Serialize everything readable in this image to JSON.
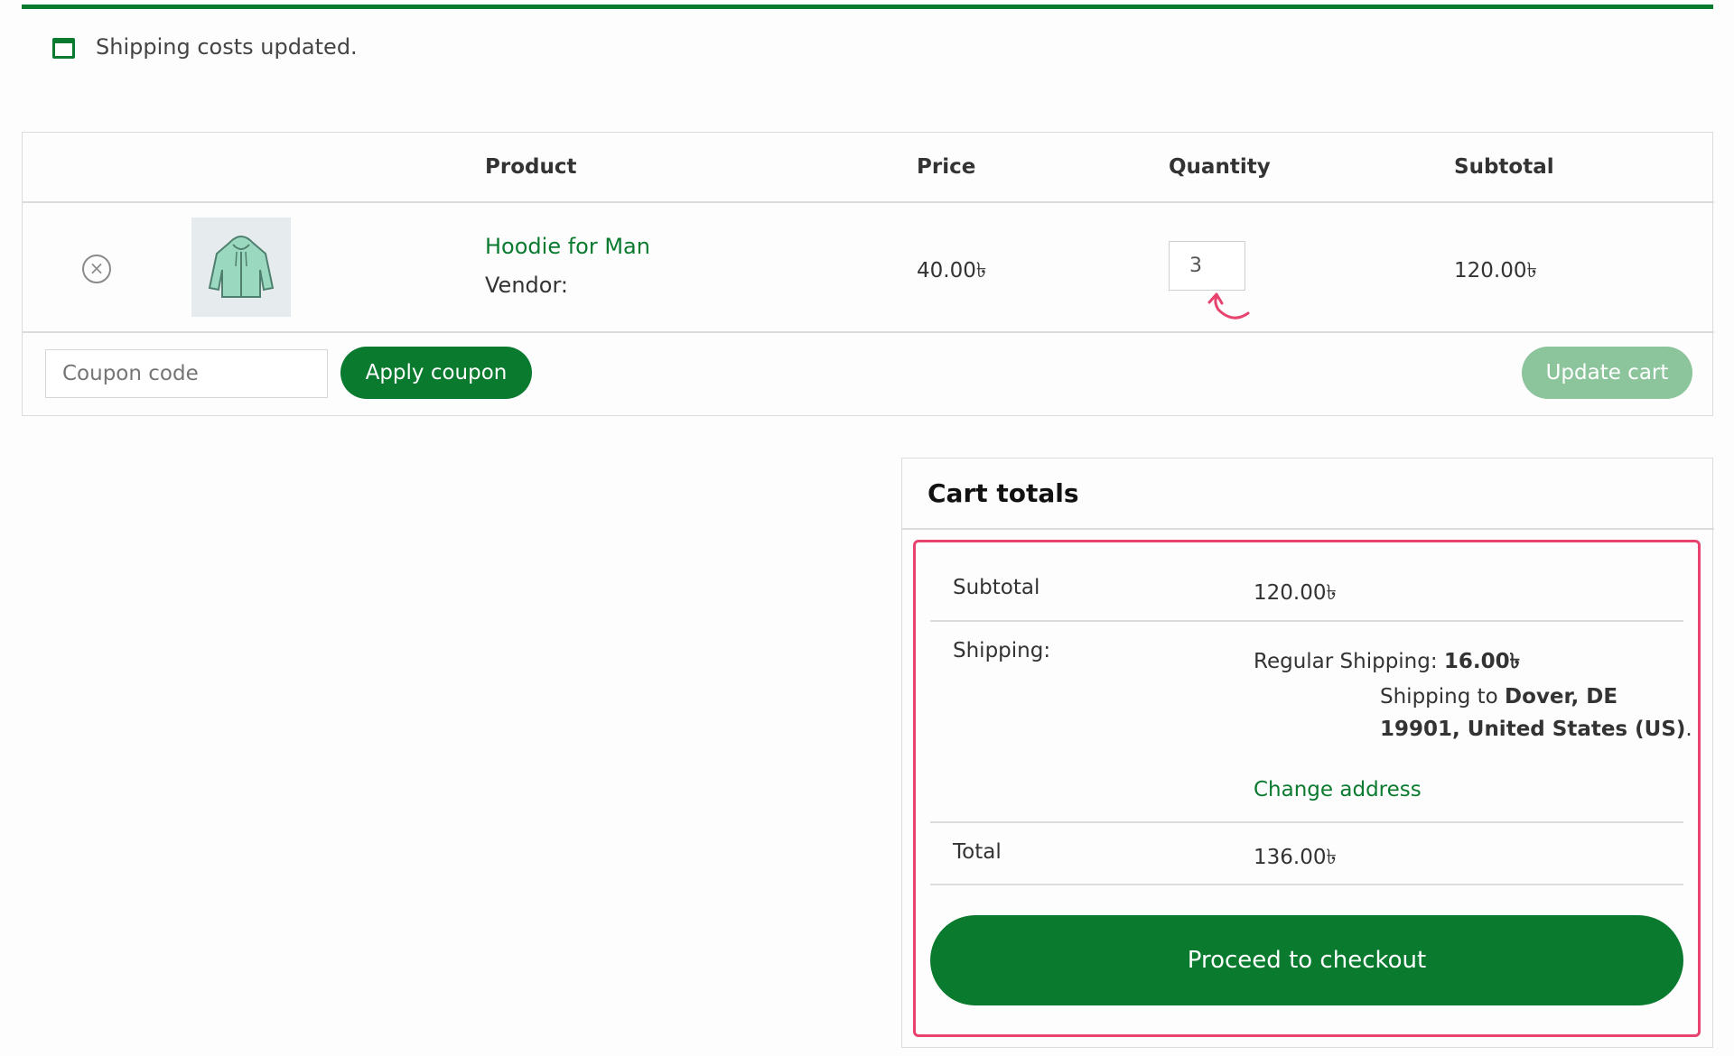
{
  "notice": {
    "text": "Shipping costs updated."
  },
  "cart_table": {
    "headers": {
      "product": "Product",
      "price": "Price",
      "quantity": "Quantity",
      "subtotal": "Subtotal"
    },
    "items": [
      {
        "name": "Hoodie for Man",
        "vendor": "Vendor:",
        "price": "40.00৳",
        "quantity": "3",
        "subtotal": "120.00৳"
      }
    ],
    "coupon_placeholder": "Coupon code",
    "apply_coupon_label": "Apply coupon",
    "update_cart_label": "Update cart"
  },
  "cart_totals": {
    "title": "Cart totals",
    "subtotal_label": "Subtotal",
    "subtotal_value": "120.00৳",
    "shipping_label": "Shipping:",
    "shipping_method": "Regular Shipping: ",
    "shipping_cost": "16.00৳",
    "shipping_to_prefix": "Shipping to ",
    "shipping_to_line1": "Dover, DE",
    "shipping_to_line2": "19901, United States (US)",
    "shipping_to_suffix": ".",
    "change_address_label": "Change address",
    "total_label": "Total",
    "total_value": "136.00৳",
    "checkout_label": "Proceed to checkout"
  },
  "colors": {
    "brand_green": "#0a7a2f",
    "annotation_pink": "#e8426e",
    "disabled_green": "#8cc49c"
  }
}
